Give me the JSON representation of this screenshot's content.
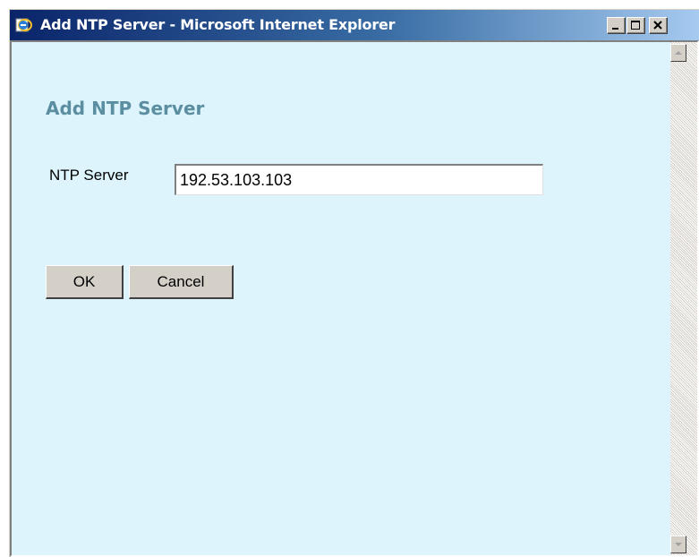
{
  "window": {
    "title": "Add NTP Server - Microsoft Internet Explorer"
  },
  "icons": {
    "app": "ie-icon",
    "minimize": "minimize-icon",
    "maximize": "maximize-icon",
    "close": "close-icon",
    "scroll_up": "scroll-up-arrow-icon",
    "scroll_down": "scroll-down-arrow-icon"
  },
  "form": {
    "heading": "Add NTP Server",
    "ntp_label": "NTP Server",
    "ntp_value": "192.53.103.103",
    "ok_label": "OK",
    "cancel_label": "Cancel"
  },
  "colors": {
    "background": "#ddf4fd",
    "heading": "#5a8ea0",
    "titlebar": "#0a246a"
  }
}
